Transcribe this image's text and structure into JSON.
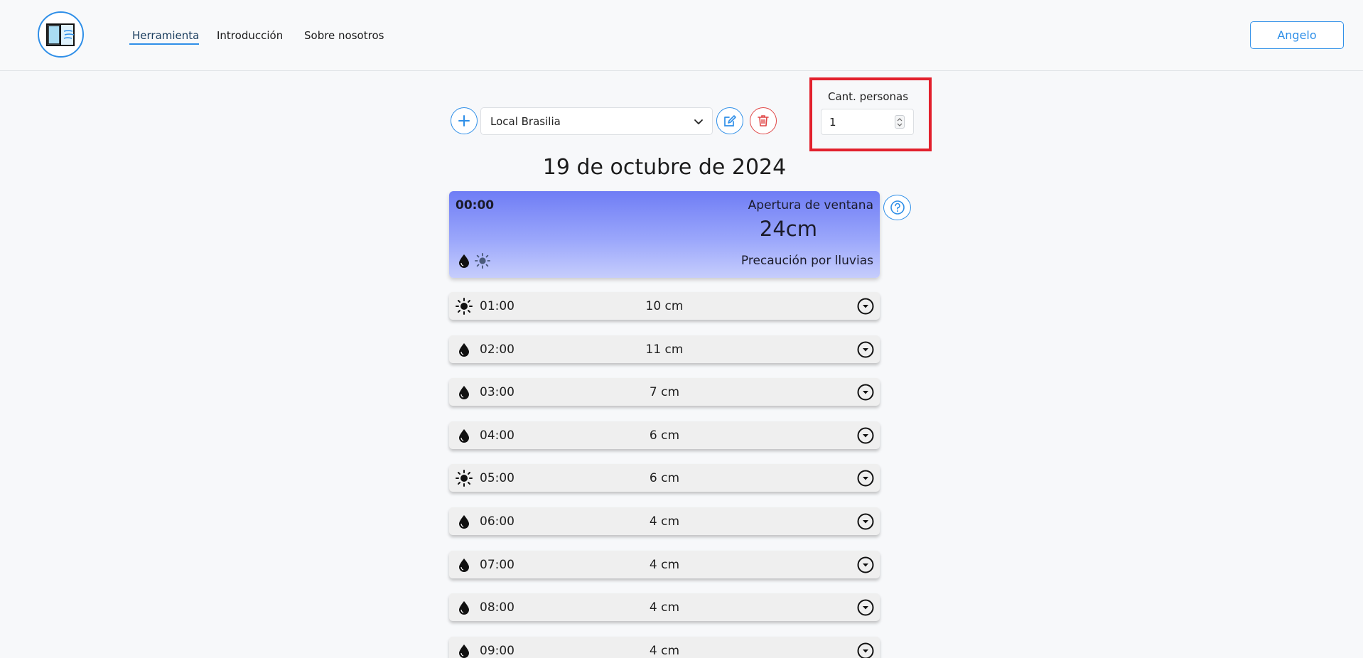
{
  "nav": {
    "links": [
      {
        "label": "Herramienta",
        "active": true
      },
      {
        "label": "Introducción",
        "active": false
      },
      {
        "label": "Sobre nosotros",
        "active": false
      }
    ],
    "user_label": "Angelo"
  },
  "toolbar": {
    "location_value": "Local Brasilia",
    "persons_label": "Cant. personas",
    "persons_value": "1"
  },
  "date_title": "19 de octubre de 2024",
  "current": {
    "time": "00:00",
    "label": "Apertura de ventana",
    "value": "24cm",
    "warning": "Precaución por lluvias",
    "icons": [
      "drop-icon",
      "sun-icon"
    ]
  },
  "hours": [
    {
      "time": "01:00",
      "value": "10 cm",
      "icon": "sun-icon"
    },
    {
      "time": "02:00",
      "value": "11 cm",
      "icon": "drop-icon"
    },
    {
      "time": "03:00",
      "value": "7 cm",
      "icon": "drop-icon"
    },
    {
      "time": "04:00",
      "value": "6 cm",
      "icon": "drop-icon"
    },
    {
      "time": "05:00",
      "value": "6 cm",
      "icon": "sun-icon"
    },
    {
      "time": "06:00",
      "value": "4 cm",
      "icon": "drop-icon"
    },
    {
      "time": "07:00",
      "value": "4 cm",
      "icon": "drop-icon"
    },
    {
      "time": "08:00",
      "value": "4 cm",
      "icon": "drop-icon"
    },
    {
      "time": "09:00",
      "value": "4 cm",
      "icon": "drop-icon"
    }
  ],
  "colors": {
    "accent": "#2f8fe8",
    "danger": "#e04646",
    "highlight": "#e2202c",
    "hero_top": "#6f7df5",
    "hero_bottom": "#c6cdfc"
  }
}
